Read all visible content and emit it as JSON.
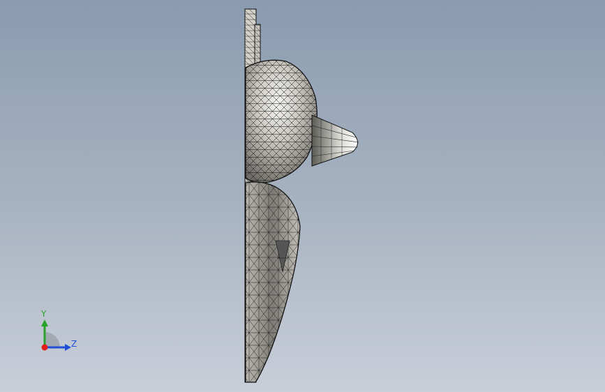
{
  "viewport": {
    "background_top": "#8a9bb0",
    "background_bottom": "#c9cfd9",
    "model_fill": "#b8b6ae",
    "mesh_line": "#1a1a1a"
  },
  "triad": {
    "y_label": "Y",
    "z_label": "Z",
    "y_color": "#2ca02c",
    "z_color": "#1f4fd6",
    "x_color": "#e0201a"
  }
}
